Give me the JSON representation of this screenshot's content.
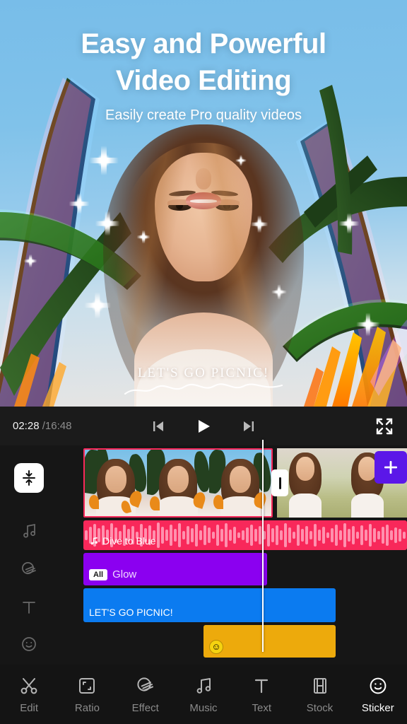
{
  "promo": {
    "headline_line1": "Easy and Powerful",
    "headline_line2": "Video Editing",
    "subhead": "Easily create Pro quality videos"
  },
  "preview": {
    "overlay_caption": "LET'S GO PICNIC!"
  },
  "player": {
    "current_time": "02:28",
    "total_time": "/16:48",
    "prev_icon": "skip-previous-icon",
    "play_icon": "play-icon",
    "next_icon": "skip-next-icon",
    "fullscreen_icon": "fullscreen-icon"
  },
  "timeline": {
    "rail": {
      "collapse_icon": "collapse-tracks-icon",
      "music_icon": "music-note-icon",
      "effect_icon": "effect-icon",
      "text_icon": "text-icon",
      "sticker_icon": "smiley-icon"
    },
    "video_track": {
      "transition_icon": "transition-icon",
      "add_clip_icon": "plus-icon"
    },
    "audio_track": {
      "label": "Dive to Blue",
      "note_icon": "music-note-icon"
    },
    "effect_track": {
      "badge": "All",
      "label": "Glow"
    },
    "text_track": {
      "label": "LET'S GO PICNIC!"
    },
    "sticker_track": {
      "emoji": "☺"
    }
  },
  "bottom_nav": {
    "items": [
      {
        "label": "Edit",
        "icon": "scissors-icon",
        "active": false
      },
      {
        "label": "Ratio",
        "icon": "ratio-icon",
        "active": false
      },
      {
        "label": "Effect",
        "icon": "effect-icon",
        "active": false
      },
      {
        "label": "Music",
        "icon": "music-note-icon",
        "active": false
      },
      {
        "label": "Text",
        "icon": "text-icon",
        "active": false
      },
      {
        "label": "Stock",
        "icon": "film-strip-icon",
        "active": false
      },
      {
        "label": "Sticker",
        "icon": "smiley-icon",
        "active": true
      }
    ]
  },
  "colors": {
    "audio": "#f8285a",
    "effect": "#8b00f0",
    "text": "#0b7bf0",
    "sticker": "#edaa0c",
    "accent": "#5b17e8",
    "background": "#141414"
  }
}
